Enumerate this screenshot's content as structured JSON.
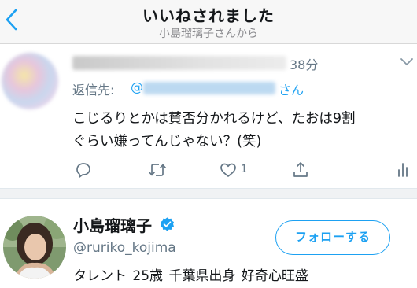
{
  "header": {
    "title": "いいねされました",
    "subtitle": "小島瑠璃子さんから"
  },
  "tweet": {
    "time": "38分",
    "reply_prefix": "返信先:",
    "reply_at": "@",
    "reply_suffix": "さん",
    "text_line1": "こじるりとかは賛否分かれるけど、たおは9割",
    "text_line2": "ぐらい嫌ってんじゃない？(笑)",
    "like_count": "1",
    "icons": [
      "reply-icon",
      "retweet-icon",
      "like-icon",
      "share-icon",
      "analytics-icon"
    ]
  },
  "profile": {
    "name": "小島瑠璃子",
    "handle": "@ruriko_kojima",
    "bio": "タレント 25歳 千葉県出身 好奇心旺盛",
    "follow_label": "フォローする"
  },
  "colors": {
    "accent": "#1da1f2",
    "secondary_text": "#657786",
    "header_bg": "#f7f7f7"
  }
}
